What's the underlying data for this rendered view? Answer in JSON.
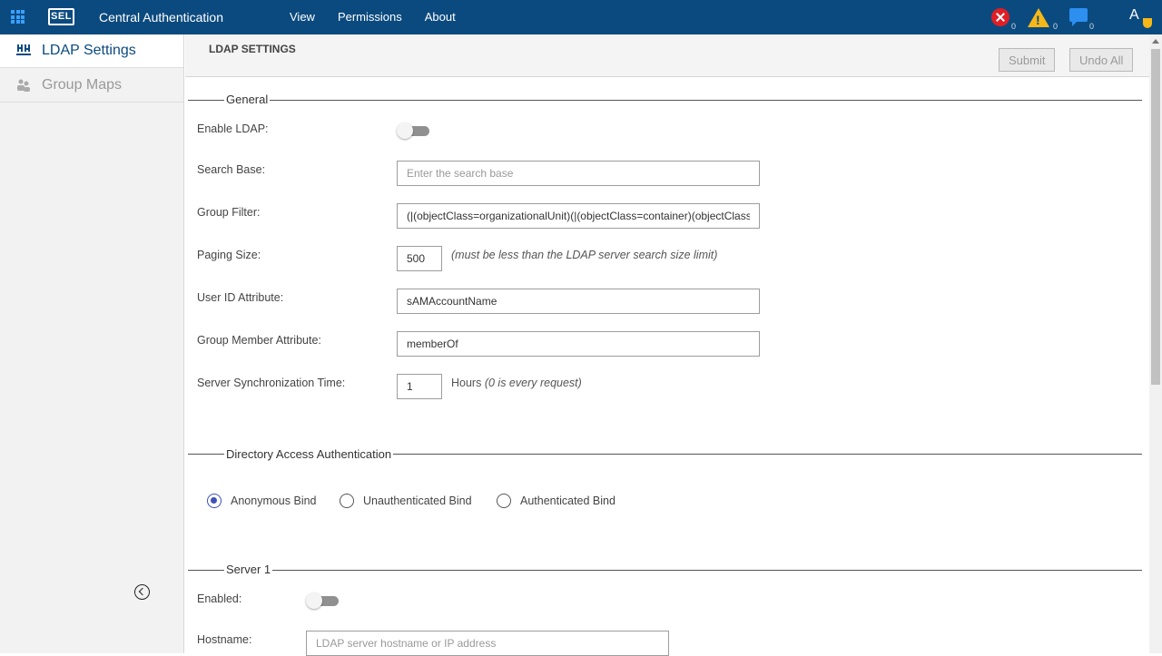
{
  "topbar": {
    "logo": "SEL",
    "app_title": "Central Authentication",
    "nav": [
      "View",
      "Permissions",
      "About"
    ],
    "notifications": {
      "errors": "0",
      "warnings": "0",
      "messages": "0"
    },
    "avatar_letter": "A",
    "colors": {
      "background": "#0b4a7f",
      "error": "#e01e26",
      "warning": "#f7b817",
      "message": "#2d8ff0"
    }
  },
  "sidebar": {
    "items": [
      {
        "label": "LDAP Settings",
        "icon": "ldap-settings-icon",
        "active": true
      },
      {
        "label": "Group Maps",
        "icon": "group-maps-icon",
        "active": false
      }
    ],
    "collapse_icon": "collapse-left-icon"
  },
  "main": {
    "title": "LDAP SETTINGS",
    "submit_label": "Submit",
    "undo_label": "Undo All",
    "general": {
      "title": "General",
      "enable_ldap_label": "Enable LDAP:",
      "enable_ldap_on": false,
      "search_base_label": "Search Base:",
      "search_base_placeholder": "Enter the search base",
      "search_base_value": "",
      "group_filter_label": "Group Filter:",
      "group_filter_value": "(|(objectClass=organizationalUnit)(|(objectClass=container)(objectClass=group)))",
      "paging_size_label": "Paging Size:",
      "paging_size_value": "500",
      "paging_size_hint": "(must be less than the LDAP server search size limit)",
      "user_id_label": "User ID Attribute:",
      "user_id_value": "sAMAccountName",
      "group_member_label": "Group Member Attribute:",
      "group_member_value": "memberOf",
      "sync_time_label": "Server Synchronization Time:",
      "sync_time_value": "1",
      "sync_time_unit": "Hours",
      "sync_time_hint": "(0 is every request)"
    },
    "directory_access": {
      "title": "Directory Access Authentication",
      "options": [
        "Anonymous Bind",
        "Unauthenticated Bind",
        "Authenticated Bind"
      ],
      "selected": "Anonymous Bind"
    },
    "server1": {
      "title": "Server 1",
      "enabled_label": "Enabled:",
      "enabled_on": false,
      "hostname_label": "Hostname:",
      "hostname_placeholder": "LDAP server hostname or IP address",
      "hostname_value": ""
    }
  }
}
